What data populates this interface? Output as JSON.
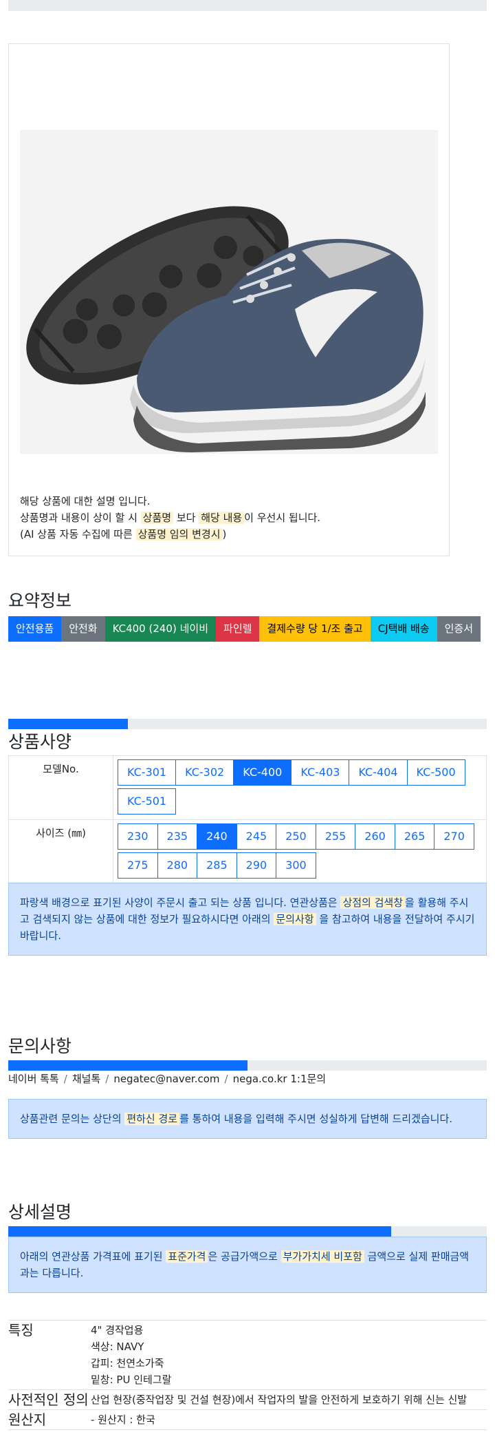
{
  "product_card": {
    "image_alt": "safety shoe photo",
    "description": {
      "line1": "해당 상품에 대한 설명 입니다.",
      "line2_pre": "상품명과 내용이 상이 할 시 ",
      "line2_hl1": "상품명",
      "line2_mid": " 보다 ",
      "line2_hl2": "해당 내용",
      "line2_post": "이 우선시 됩니다.",
      "line3_pre": "(AI 상품 자동 수집에 따른 ",
      "line3_hl": "상품명 임의 변경시",
      "line3_post": ")"
    }
  },
  "summary": {
    "title": "요약정보",
    "badges": [
      "안전용품",
      "안전화",
      "KC400 (240) 네이비",
      "파인렐",
      "결제수량 당 1/조 출고",
      "CJ택배 배송",
      "인증서"
    ]
  },
  "spec": {
    "title": "상품사양",
    "progress": 0.25,
    "model_label": "모델No.",
    "models": [
      "KC-301",
      "KC-302",
      "KC-400",
      "KC-403",
      "KC-404",
      "KC-500",
      "KC-501"
    ],
    "selected_model": "KC-400",
    "size_label": "사이즈 (㎜)",
    "sizes": [
      "230",
      "235",
      "240",
      "245",
      "250",
      "255",
      "260",
      "265",
      "270",
      "275",
      "280",
      "285",
      "290",
      "300"
    ],
    "selected_size": "240",
    "notice": {
      "pre": "파랑색 배경으로 표기된 사양이 주문시 출고 되는 상품 입니다. 연관상품은 ",
      "hl1": "상점의 검색창",
      "mid": "을 활용해 주시고 검색되지 않는 상품에 대한 정보가 필요하시다면 아래의 ",
      "hl2": "문의사항",
      "post": " 을 참고하여 내용을 전달하여 주시기 바랍니다."
    }
  },
  "inquiry": {
    "title": "문의사항",
    "progress": 0.5,
    "contacts": [
      "네이버 톡톡",
      "채널톡",
      "negatec@naver.com",
      "nega.co.kr 1:1문의"
    ],
    "notice": {
      "pre": "상품관련 문의는 상단의 ",
      "hl": "편하신 경로",
      "post": "를 통하여 내용을 입력해 주시면 성실하게 답변해 드리겠습니다."
    }
  },
  "detail": {
    "title": "상세설명",
    "progress": 0.8,
    "notice": {
      "pre": "아래의 연관상품 가격표에 표기된 ",
      "hl1": "표준가격",
      "mid": "은 공급가액으로 ",
      "hl2": "부가가치세 비포함",
      "post": " 금액으로 실제 판매금액과는 다릅니다."
    },
    "rows": [
      {
        "key": "특징",
        "values": [
          "4\" 경작업용",
          "색상: NAVY",
          "갑피: 천연소가죽",
          "밑창: PU 인테그랄"
        ]
      },
      {
        "key": "사전적인 정의",
        "values": [
          "산업 현장(중작업장 및 건설 현장)에서 작업자의 발을 안전하게 보호하기 위해 신는 신발"
        ]
      },
      {
        "key": "원산지",
        "values": [
          "- 원산지 : 한국"
        ]
      }
    ]
  }
}
